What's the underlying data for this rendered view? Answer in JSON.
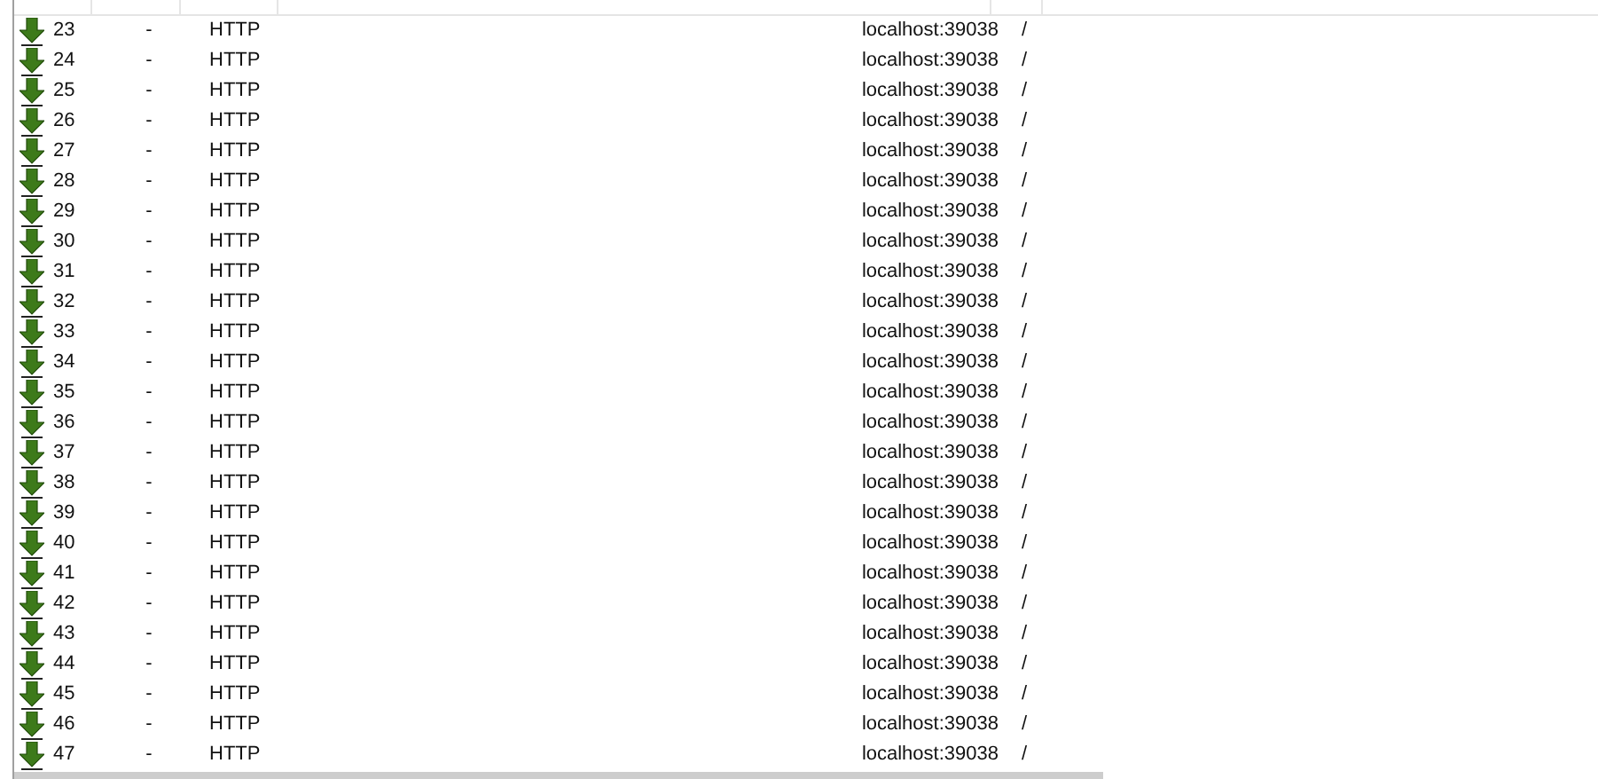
{
  "sessions": [
    {
      "number": "23",
      "result": "-",
      "protocol": "HTTP",
      "host": "localhost:39038",
      "url": "/"
    },
    {
      "number": "24",
      "result": "-",
      "protocol": "HTTP",
      "host": "localhost:39038",
      "url": "/"
    },
    {
      "number": "25",
      "result": "-",
      "protocol": "HTTP",
      "host": "localhost:39038",
      "url": "/"
    },
    {
      "number": "26",
      "result": "-",
      "protocol": "HTTP",
      "host": "localhost:39038",
      "url": "/"
    },
    {
      "number": "27",
      "result": "-",
      "protocol": "HTTP",
      "host": "localhost:39038",
      "url": "/"
    },
    {
      "number": "28",
      "result": "-",
      "protocol": "HTTP",
      "host": "localhost:39038",
      "url": "/"
    },
    {
      "number": "29",
      "result": "-",
      "protocol": "HTTP",
      "host": "localhost:39038",
      "url": "/"
    },
    {
      "number": "30",
      "result": "-",
      "protocol": "HTTP",
      "host": "localhost:39038",
      "url": "/"
    },
    {
      "number": "31",
      "result": "-",
      "protocol": "HTTP",
      "host": "localhost:39038",
      "url": "/"
    },
    {
      "number": "32",
      "result": "-",
      "protocol": "HTTP",
      "host": "localhost:39038",
      "url": "/"
    },
    {
      "number": "33",
      "result": "-",
      "protocol": "HTTP",
      "host": "localhost:39038",
      "url": "/"
    },
    {
      "number": "34",
      "result": "-",
      "protocol": "HTTP",
      "host": "localhost:39038",
      "url": "/"
    },
    {
      "number": "35",
      "result": "-",
      "protocol": "HTTP",
      "host": "localhost:39038",
      "url": "/"
    },
    {
      "number": "36",
      "result": "-",
      "protocol": "HTTP",
      "host": "localhost:39038",
      "url": "/"
    },
    {
      "number": "37",
      "result": "-",
      "protocol": "HTTP",
      "host": "localhost:39038",
      "url": "/"
    },
    {
      "number": "38",
      "result": "-",
      "protocol": "HTTP",
      "host": "localhost:39038",
      "url": "/"
    },
    {
      "number": "39",
      "result": "-",
      "protocol": "HTTP",
      "host": "localhost:39038",
      "url": "/"
    },
    {
      "number": "40",
      "result": "-",
      "protocol": "HTTP",
      "host": "localhost:39038",
      "url": "/"
    },
    {
      "number": "41",
      "result": "-",
      "protocol": "HTTP",
      "host": "localhost:39038",
      "url": "/"
    },
    {
      "number": "42",
      "result": "-",
      "protocol": "HTTP",
      "host": "localhost:39038",
      "url": "/"
    },
    {
      "number": "43",
      "result": "-",
      "protocol": "HTTP",
      "host": "localhost:39038",
      "url": "/"
    },
    {
      "number": "44",
      "result": "-",
      "protocol": "HTTP",
      "host": "localhost:39038",
      "url": "/"
    },
    {
      "number": "45",
      "result": "-",
      "protocol": "HTTP",
      "host": "localhost:39038",
      "url": "/"
    },
    {
      "number": "46",
      "result": "-",
      "protocol": "HTTP",
      "host": "localhost:39038",
      "url": "/"
    },
    {
      "number": "47",
      "result": "-",
      "protocol": "HTTP",
      "host": "localhost:39038",
      "url": "/"
    }
  ]
}
